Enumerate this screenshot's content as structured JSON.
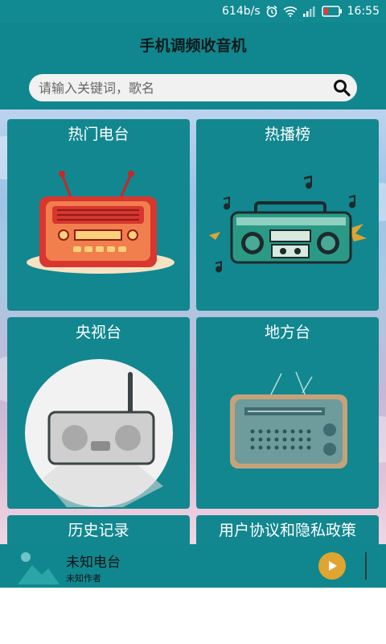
{
  "status_bar": {
    "net_speed": "614b/s",
    "time": "16:55",
    "icons": [
      "alarm-icon",
      "wifi-icon",
      "signal-icon",
      "battery-icon"
    ]
  },
  "app": {
    "title": "手机调频收音机"
  },
  "search": {
    "placeholder": "请输入关键词，歌名",
    "value": ""
  },
  "cards": [
    {
      "label": "热门电台",
      "icon": "vintage-radio-icon"
    },
    {
      "label": "热播榜",
      "icon": "boombox-icon"
    },
    {
      "label": "央视台",
      "icon": "portable-radio-icon"
    },
    {
      "label": "地方台",
      "icon": "retro-radio-icon"
    },
    {
      "label": "历史记录"
    },
    {
      "label": "用户协议和隐私政策"
    }
  ],
  "player": {
    "title": "未知电台",
    "author": "未知作者",
    "icons": [
      "image-placeholder-icon",
      "play-icon"
    ]
  },
  "colors": {
    "primary": "#10878f",
    "card": "#12878f",
    "accent": "#e0a431"
  }
}
